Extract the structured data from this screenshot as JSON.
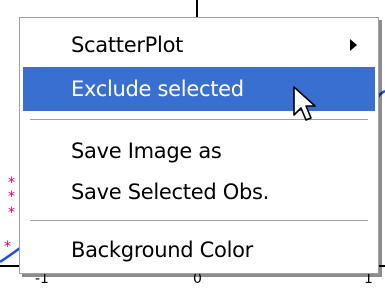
{
  "plot": {
    "x_tick_labels": [
      "-1",
      "0",
      "1"
    ],
    "marker_glyph": "*",
    "curve_color": "#1f4fe0",
    "marker_color": "#cc0066"
  },
  "context_menu": {
    "items": [
      {
        "label": "ScatterPlot",
        "has_submenu": true,
        "selected": false
      },
      {
        "label": "Exclude selected",
        "has_submenu": false,
        "selected": true
      },
      {
        "label": "Save Image as",
        "has_submenu": false,
        "selected": false
      },
      {
        "label": "Save Selected Obs.",
        "has_submenu": false,
        "selected": false
      },
      {
        "label": "Background Color",
        "has_submenu": false,
        "selected": false
      }
    ],
    "highlight_color": "#3a6fd2"
  },
  "cursor": "arrow-pointer-icon"
}
